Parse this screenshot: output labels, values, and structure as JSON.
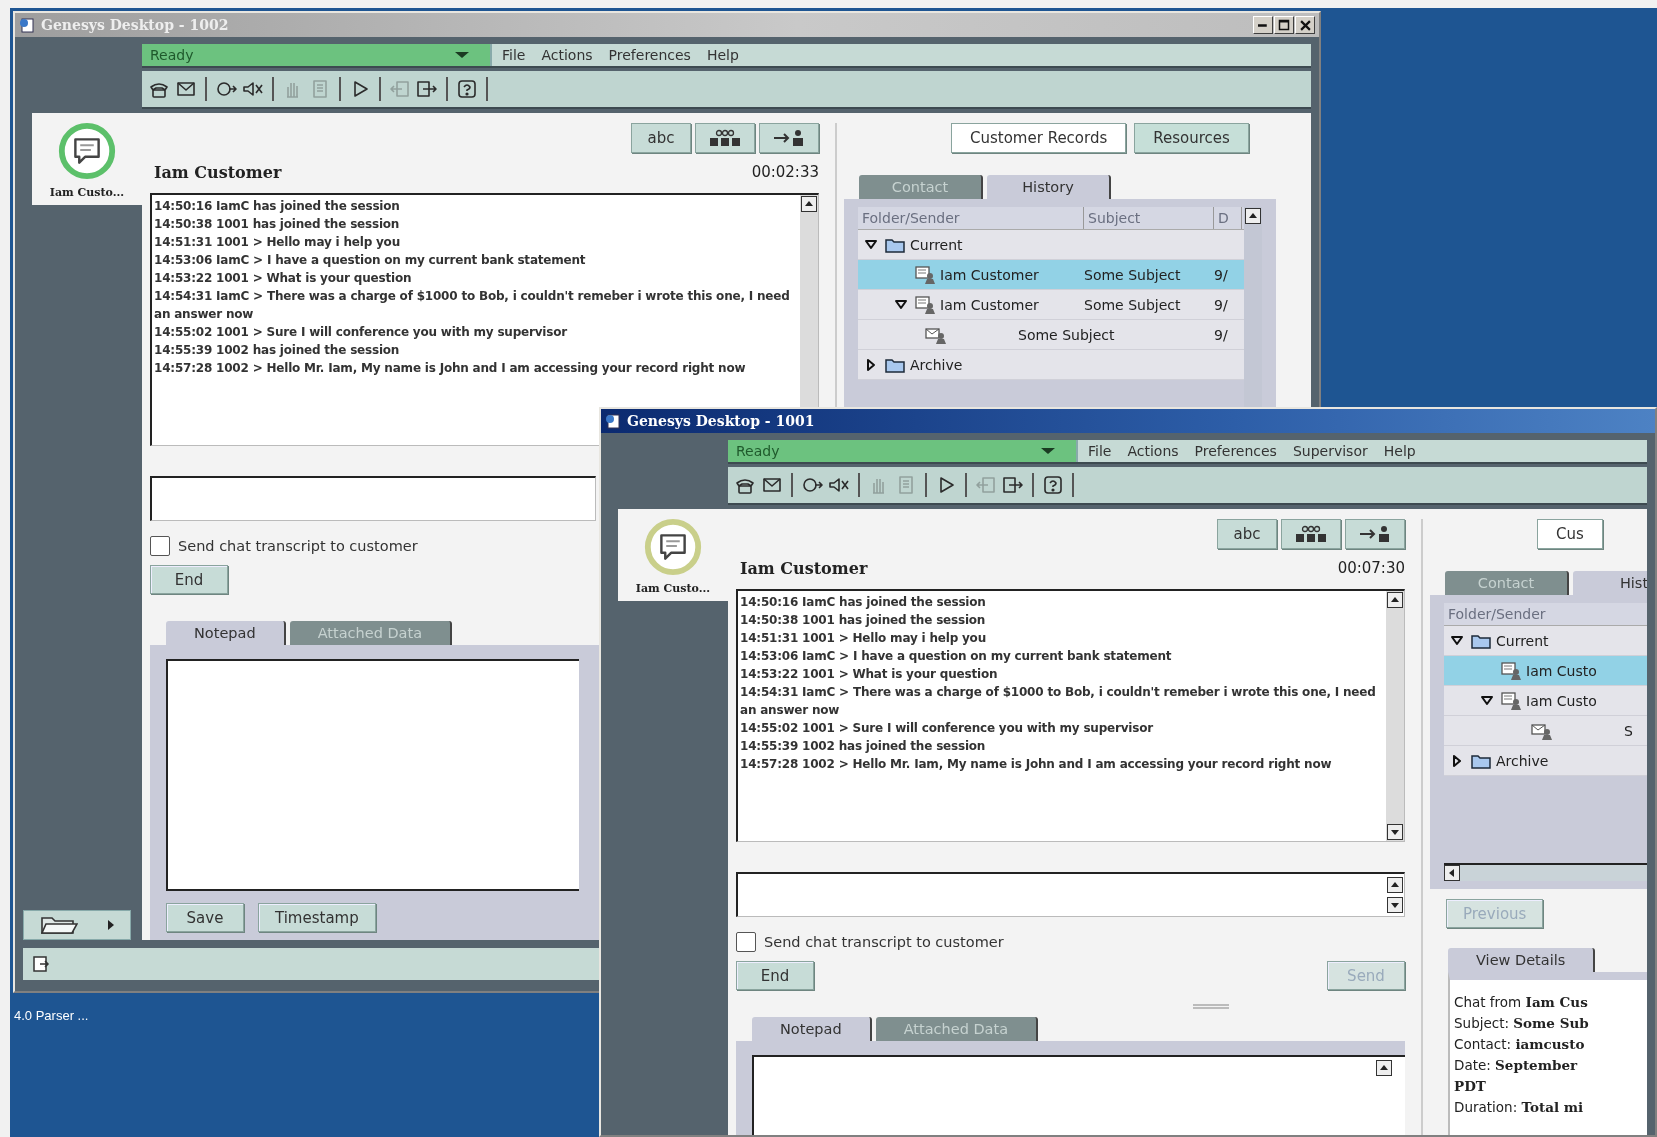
{
  "desktop": {
    "label": "4.0 Parser ..."
  },
  "windows": [
    {
      "title": "Genesys Desktop - 1002",
      "active": false,
      "status": {
        "label": "Ready"
      },
      "menu": [
        "File",
        "Actions",
        "Preferences",
        "Help"
      ],
      "toolbar": [
        [
          {
            "kind": "phone",
            "disabled": false
          },
          {
            "kind": "mail",
            "disabled": false
          }
        ],
        [
          {
            "kind": "release",
            "disabled": false
          },
          {
            "kind": "mute",
            "disabled": false
          }
        ],
        [
          {
            "kind": "hand",
            "disabled": true
          },
          {
            "kind": "page",
            "disabled": true
          }
        ],
        [
          {
            "kind": "play",
            "disabled": false
          }
        ],
        [
          {
            "kind": "back",
            "disabled": true
          },
          {
            "kind": "exit",
            "disabled": false
          }
        ],
        [
          {
            "kind": "help",
            "disabled": false
          }
        ]
      ],
      "avatar": {
        "label": "Iam Custo...",
        "color": "#5cc06a"
      },
      "chat_tools": [
        {
          "kind": "spell",
          "label": "abc"
        },
        {
          "kind": "conference"
        },
        {
          "kind": "transfer"
        }
      ],
      "contact_name": "Iam Customer",
      "timer": "00:02:33",
      "chat_lines": [
        "14:50:16 IamC has joined the session",
        "14:50:38 1001 has joined the session",
        "14:51:31 1001 > Hello may i help you",
        "14:53:06 IamC > I have a question on my current bank statement",
        "14:53:22 1001 > What is your question",
        "14:54:31 IamC > There was a charge of $1000 to Bob, i couldn't remeber i wrote this one, I need an answer now",
        "14:55:02 1001 > Sure I will conference you with my supervisor",
        "14:55:39 1002 has joined the session",
        "14:57:28 1002 > Hello Mr. Iam, My name is John and I am accessing your record right now"
      ],
      "transcript_option": {
        "label": "Send chat transcript to customer",
        "checked": false
      },
      "actions": [
        {
          "label": "End",
          "disabled": false
        }
      ],
      "notepad_tabs": [
        {
          "label": "Notepad",
          "selected": true
        },
        {
          "label": "Attached Data",
          "selected": false
        }
      ],
      "notepad_buttons": [
        "Save",
        "Timestamp"
      ],
      "panel_tabs": [
        {
          "label": "Customer Records",
          "selected": true
        },
        {
          "label": "Resources",
          "selected": false
        }
      ],
      "record_tabs": [
        {
          "label": "Contact",
          "selected": false
        },
        {
          "label": "History",
          "selected": true
        }
      ],
      "columns": [
        "Folder/Sender",
        "Subject",
        "D"
      ],
      "tree": [
        {
          "kind": "folder",
          "label": "Current",
          "expanded": true,
          "selected": false,
          "children": [
            {
              "kind": "interaction",
              "label": "Iam Customer",
              "subject": "Some Subject",
              "date": "9/",
              "selected": true
            },
            {
              "kind": "interaction",
              "label": "Iam Customer",
              "subject": "Some Subject",
              "date": "9/",
              "expanded": true,
              "selected": false,
              "children": [
                {
                  "kind": "message",
                  "label": "Some Subject",
                  "date": "9/",
                  "selected": false
                }
              ]
            }
          ]
        },
        {
          "kind": "folder",
          "label": "Archive",
          "expanded": false,
          "selected": false
        }
      ]
    },
    {
      "title": "Genesys Desktop - 1001",
      "active": true,
      "status": {
        "label": "Ready"
      },
      "menu": [
        "File",
        "Actions",
        "Preferences",
        "Supervisor",
        "Help"
      ],
      "toolbar": [
        [
          {
            "kind": "phone",
            "disabled": false
          },
          {
            "kind": "mail",
            "disabled": false
          }
        ],
        [
          {
            "kind": "release",
            "disabled": false
          },
          {
            "kind": "mute",
            "disabled": false
          }
        ],
        [
          {
            "kind": "hand",
            "disabled": true
          },
          {
            "kind": "page",
            "disabled": true
          }
        ],
        [
          {
            "kind": "play",
            "disabled": false
          }
        ],
        [
          {
            "kind": "back",
            "disabled": true
          },
          {
            "kind": "exit",
            "disabled": false
          }
        ],
        [
          {
            "kind": "help",
            "disabled": false
          }
        ]
      ],
      "avatar": {
        "label": "Iam Custo...",
        "color": "#c9cf8a"
      },
      "chat_tools": [
        {
          "kind": "spell",
          "label": "abc"
        },
        {
          "kind": "conference"
        },
        {
          "kind": "transfer"
        }
      ],
      "contact_name": "Iam Customer",
      "timer": "00:07:30",
      "chat_lines": [
        "14:50:16 IamC has joined the session",
        "14:50:38 1001 has joined the session",
        "14:51:31 1001 > Hello may i help you",
        "14:53:06 IamC > I have a question on my current bank statement",
        "14:53:22 1001 > What is your question",
        "14:54:31 IamC > There was a charge of $1000 to Bob, i couldn't remeber i wrote this one, I need an answer now",
        "14:55:02 1001 > Sure I will conference you with my supervisor",
        "14:55:39 1002 has joined the session",
        "14:57:28 1002 > Hello Mr. Iam, My name is John and I am accessing your record right now"
      ],
      "transcript_option": {
        "label": "Send chat transcript to customer",
        "checked": false
      },
      "actions": [
        {
          "label": "End",
          "disabled": false
        },
        {
          "label": "Send",
          "disabled": true
        }
      ],
      "notepad_tabs": [
        {
          "label": "Notepad",
          "selected": true
        },
        {
          "label": "Attached Data",
          "selected": false
        }
      ],
      "panel_tabs": [
        {
          "label": "Cus",
          "selected": true
        }
      ],
      "record_tabs": [
        {
          "label": "Contact",
          "selected": false
        },
        {
          "label": "Hist",
          "selected": true
        }
      ],
      "columns": [
        "Folder/Sender"
      ],
      "tree": [
        {
          "kind": "folder",
          "label": "Current",
          "expanded": true,
          "selected": false,
          "children": [
            {
              "kind": "interaction",
              "label": "Iam Custo",
              "selected": true
            },
            {
              "kind": "interaction",
              "label": "Iam Custo",
              "expanded": true,
              "selected": false,
              "children": [
                {
                  "kind": "message",
                  "label": "S",
                  "selected": false
                }
              ]
            }
          ]
        },
        {
          "kind": "folder",
          "label": "Archive",
          "expanded": false,
          "selected": false
        }
      ],
      "previous": {
        "label": "Previous",
        "disabled": true
      },
      "detail_tabs": [
        {
          "label": "View Details",
          "selected": true
        }
      ],
      "details": [
        {
          "label": "Chat from",
          "value": "Iam Cus"
        },
        {
          "label": "Subject:",
          "value": "Some Sub"
        },
        {
          "label": "Contact:",
          "value": "iamcusto"
        },
        {
          "label": "Date:",
          "value": "September",
          "more": "PDT"
        },
        {
          "label": "Duration:",
          "value": "Total mi"
        }
      ]
    }
  ]
}
